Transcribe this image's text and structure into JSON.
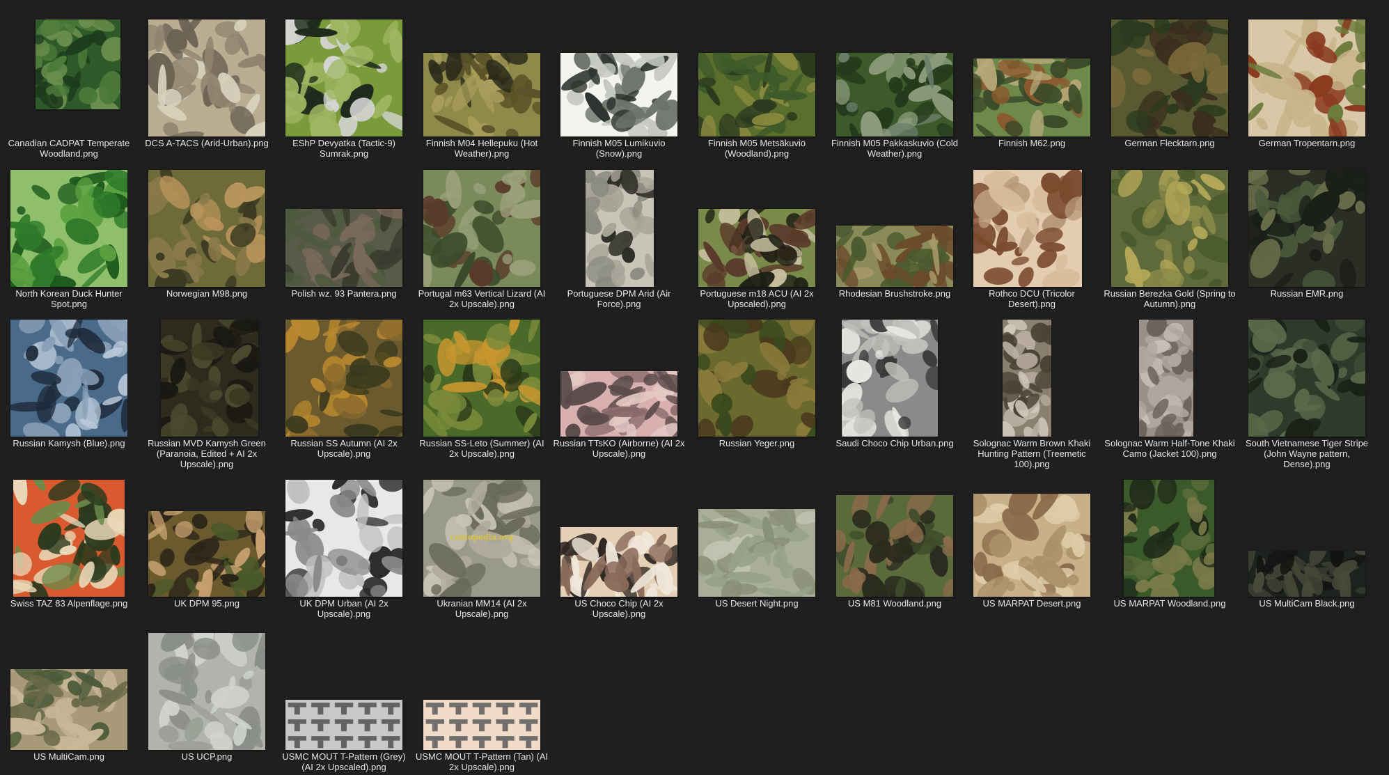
{
  "view": "Large icons",
  "files": [
    {
      "name": "Canadian CADPAT Temperate Woodland.png",
      "pattern": "camo",
      "colors": [
        "#2e5a2a",
        "#4c7a3a",
        "#1c3a1c",
        "#6b8f4e"
      ]
    },
    {
      "name": "DCS A-TACS (Arid-Urban).png",
      "pattern": "camo",
      "colors": [
        "#b9ae92",
        "#8f8470",
        "#d8d2bd",
        "#6d6354"
      ]
    },
    {
      "name": "EShP Devyatka (Tactic-9) Sumrak.png",
      "pattern": "camo",
      "colors": [
        "#7a9a3c",
        "#d7d7d7",
        "#1e2a1c",
        "#9fb561"
      ]
    },
    {
      "name": "Finnish M04 Hellepuku (Hot Weather).png",
      "pattern": "camo",
      "colors": [
        "#8d8a4a",
        "#5a5228",
        "#2a2a1a",
        "#a89c5a"
      ]
    },
    {
      "name": "Finnish M05 Lumikuvio (Snow).png",
      "pattern": "camo",
      "colors": [
        "#f4f4ee",
        "#6e746c",
        "#2f3430",
        "#c4c8c0"
      ]
    },
    {
      "name": "Finnish M05 Metsäkuvio (Woodland).png",
      "pattern": "camo",
      "colors": [
        "#5a6e2e",
        "#8a8a3e",
        "#2c3a1e",
        "#3d5a2a"
      ]
    },
    {
      "name": "Finnish M05 Pakkaskuvio (Cold Weather).png",
      "pattern": "camo",
      "colors": [
        "#3d5a2a",
        "#6a7e6a",
        "#243a1c",
        "#8a9a7a"
      ]
    },
    {
      "name": "Finnish M62.png",
      "pattern": "camo",
      "colors": [
        "#6e8a4a",
        "#8a5a2e",
        "#b6a878",
        "#3a4a2a"
      ]
    },
    {
      "name": "German Flecktarn.png",
      "pattern": "camo",
      "colors": [
        "#5a5a32",
        "#3a2e1e",
        "#7a6a3a",
        "#2a3a1e"
      ]
    },
    {
      "name": "German Tropentarn.png",
      "pattern": "camo",
      "colors": [
        "#d8c8a8",
        "#8a3a1e",
        "#6a7a3a",
        "#c8b48a"
      ]
    },
    {
      "name": "North Korean Duck Hunter Spot.png",
      "pattern": "camo",
      "colors": [
        "#8fbf6a",
        "#2e7a2a",
        "#5aa040",
        "#1e5a1e"
      ]
    },
    {
      "name": "Norwegian M98.png",
      "pattern": "camo",
      "colors": [
        "#6e6a3a",
        "#b8945a",
        "#3a3a22",
        "#8a7a4a"
      ]
    },
    {
      "name": "Polish wz. 93 Pantera.png",
      "pattern": "camo",
      "colors": [
        "#5a5a4a",
        "#7a6a5a",
        "#3a3a2e",
        "#4e5a3e"
      ]
    },
    {
      "name": "Portugal m63 Vertical Lizard (AI 2x Upscale).png",
      "pattern": "camo",
      "colors": [
        "#7a8a5a",
        "#5a3a2a",
        "#3a4a2a",
        "#9aa07a"
      ]
    },
    {
      "name": "Portuguese DPM Arid (Air Force).png",
      "pattern": "camo",
      "colors": [
        "#c8c4b8",
        "#8a8a7e",
        "#2a2a24",
        "#a8a498"
      ]
    },
    {
      "name": "Portuguese m18 ACU (AI 2x Upscaled).png",
      "pattern": "camo",
      "colors": [
        "#7a8a4a",
        "#1e1e14",
        "#c8c0a0",
        "#5a3a2a"
      ]
    },
    {
      "name": "Rhodesian Brushstroke.png",
      "pattern": "camo",
      "colors": [
        "#8a8a5a",
        "#4a5a2e",
        "#6a4a2a",
        "#a89a6a"
      ]
    },
    {
      "name": "Rothco DCU (Tricolor Desert).png",
      "pattern": "camo",
      "colors": [
        "#e4ccb0",
        "#b89a7a",
        "#7a4a2e",
        "#d8bc9a"
      ]
    },
    {
      "name": "Russian Berezka Gold (Spring to Autumn).png",
      "pattern": "camo",
      "colors": [
        "#5e6a3a",
        "#b4a858",
        "#4a5a2e",
        "#8a8a48"
      ]
    },
    {
      "name": "Russian EMR.png",
      "pattern": "camo",
      "colors": [
        "#2a2e24",
        "#4a5a3a",
        "#1a1e18",
        "#6a6e4a"
      ]
    },
    {
      "name": "Russian Kamysh (Blue).png",
      "pattern": "camo",
      "colors": [
        "#4a6a8a",
        "#b8c8d8",
        "#1e2a3a",
        "#8aa0b8"
      ]
    },
    {
      "name": "Russian MVD Kamysh Green (Paranoia, Edited + AI 2x Upscale).png",
      "pattern": "camo",
      "colors": [
        "#2e2a1e",
        "#4a4a2e",
        "#1a1812",
        "#3a3a24"
      ]
    },
    {
      "name": "Russian SS Autumn (AI 2x Upscale).png",
      "pattern": "camo",
      "colors": [
        "#6a5a2e",
        "#b8882e",
        "#3a3a1e",
        "#8a6a2e"
      ]
    },
    {
      "name": "Russian SS-Leto (Summer) (AI 2x Upscale).png",
      "pattern": "camo",
      "colors": [
        "#4a6a2a",
        "#c8962e",
        "#2a3a1a",
        "#7a8a3a"
      ]
    },
    {
      "name": "Russian TTsKO (Airborne) (AI 2x Upscale).png",
      "pattern": "camo",
      "colors": [
        "#d8b0b0",
        "#8a6a6a",
        "#5a4a4a",
        "#e4c8c4"
      ]
    },
    {
      "name": "Russian Yeger.png",
      "pattern": "camo",
      "colors": [
        "#6a6a2e",
        "#4a3a1e",
        "#8a7a3a",
        "#3a4a1e"
      ]
    },
    {
      "name": "Saudi Choco Chip Urban.png",
      "pattern": "camo",
      "colors": [
        "#8a8a8a",
        "#c0c0bc",
        "#3a3a3a",
        "#e8e8e4"
      ]
    },
    {
      "name": "Solognac Warm Brown Khaki Hunting Pattern (Treemetic 100).png",
      "pattern": "camo",
      "colors": [
        "#8a8070",
        "#b8ada0",
        "#4a4236",
        "#d0c8bc"
      ]
    },
    {
      "name": "Solognac Warm Half-Tone Khaki Camo (Jacket 100).png",
      "pattern": "camo",
      "colors": [
        "#9a9088",
        "#c8c0b8",
        "#6a625a",
        "#b0a8a0"
      ]
    },
    {
      "name": "South Vietnamese Tiger Stripe (John Wayne pattern, Dense).png",
      "pattern": "camo",
      "colors": [
        "#2e3a2a",
        "#5a6a4a",
        "#1a2218",
        "#3e4a36"
      ]
    },
    {
      "name": "Swiss TAZ 83 Alpenflage.png",
      "pattern": "camo",
      "colors": [
        "#d85a2e",
        "#e8d8b8",
        "#2a3a1e",
        "#6a8a4a"
      ]
    },
    {
      "name": "UK DPM 95.png",
      "pattern": "camo",
      "colors": [
        "#6a5a2e",
        "#c8a070",
        "#2a2418",
        "#4a5a2a"
      ]
    },
    {
      "name": "UK DPM Urban (AI 2x Upscale).png",
      "pattern": "camo",
      "colors": [
        "#e8e8e8",
        "#8a8a8a",
        "#2a2a2a",
        "#c0c0c0"
      ]
    },
    {
      "name": "Ukranian MM14 (AI 2x Upscale).png",
      "pattern": "camo",
      "colors": [
        "#9a9a8a",
        "#c8c4b8",
        "#6a6a5a",
        "#b0ab9e"
      ],
      "watermark": "camopedia.org"
    },
    {
      "name": "US Choco Chip (AI 2x Upscale).png",
      "pattern": "camo",
      "colors": [
        "#e4d0b4",
        "#8a6a5a",
        "#2e2622",
        "#f0e8dc"
      ]
    },
    {
      "name": "US Desert Night.png",
      "pattern": "camo",
      "colors": [
        "#a8ae98",
        "#8a9078",
        "#c0c4b0",
        "#98a088"
      ]
    },
    {
      "name": "US M81 Woodland.png",
      "pattern": "camo",
      "colors": [
        "#5a6a3a",
        "#8a6a4a",
        "#2a2a1e",
        "#3e4a2a"
      ]
    },
    {
      "name": "US MARPAT Desert.png",
      "pattern": "camo",
      "colors": [
        "#c8b08a",
        "#8a6a4a",
        "#e0cca8",
        "#a8906a"
      ]
    },
    {
      "name": "US MARPAT Woodland.png",
      "pattern": "camo",
      "colors": [
        "#3a5a2a",
        "#7a7a4a",
        "#1e2a18",
        "#5a6a3a"
      ]
    },
    {
      "name": "US MultiCam Black.png",
      "pattern": "camo",
      "colors": [
        "#1e221e",
        "#3a3e32",
        "#121412",
        "#4a4a3a"
      ]
    },
    {
      "name": "US MultiCam.png",
      "pattern": "camo",
      "colors": [
        "#a89a78",
        "#6a6a4a",
        "#c8b898",
        "#4a5a3a"
      ]
    },
    {
      "name": "US UCP.png",
      "pattern": "camo",
      "colors": [
        "#b0b4ac",
        "#8a8e88",
        "#d0d4cc",
        "#9a9e96"
      ]
    },
    {
      "name": "USMC MOUT T-Pattern (Grey) (AI 2x Upscaled).png",
      "pattern": "tpattern",
      "colors": [
        "#a0a0a0",
        "#505050",
        "#c8c8c8",
        "#787878"
      ]
    },
    {
      "name": "USMC MOUT T-Pattern (Tan) (AI 2x Upscale).png",
      "pattern": "tpattern",
      "colors": [
        "#e4ccb4",
        "#5a5a5a",
        "#f0dcc8",
        "#8a8a8a"
      ]
    }
  ]
}
